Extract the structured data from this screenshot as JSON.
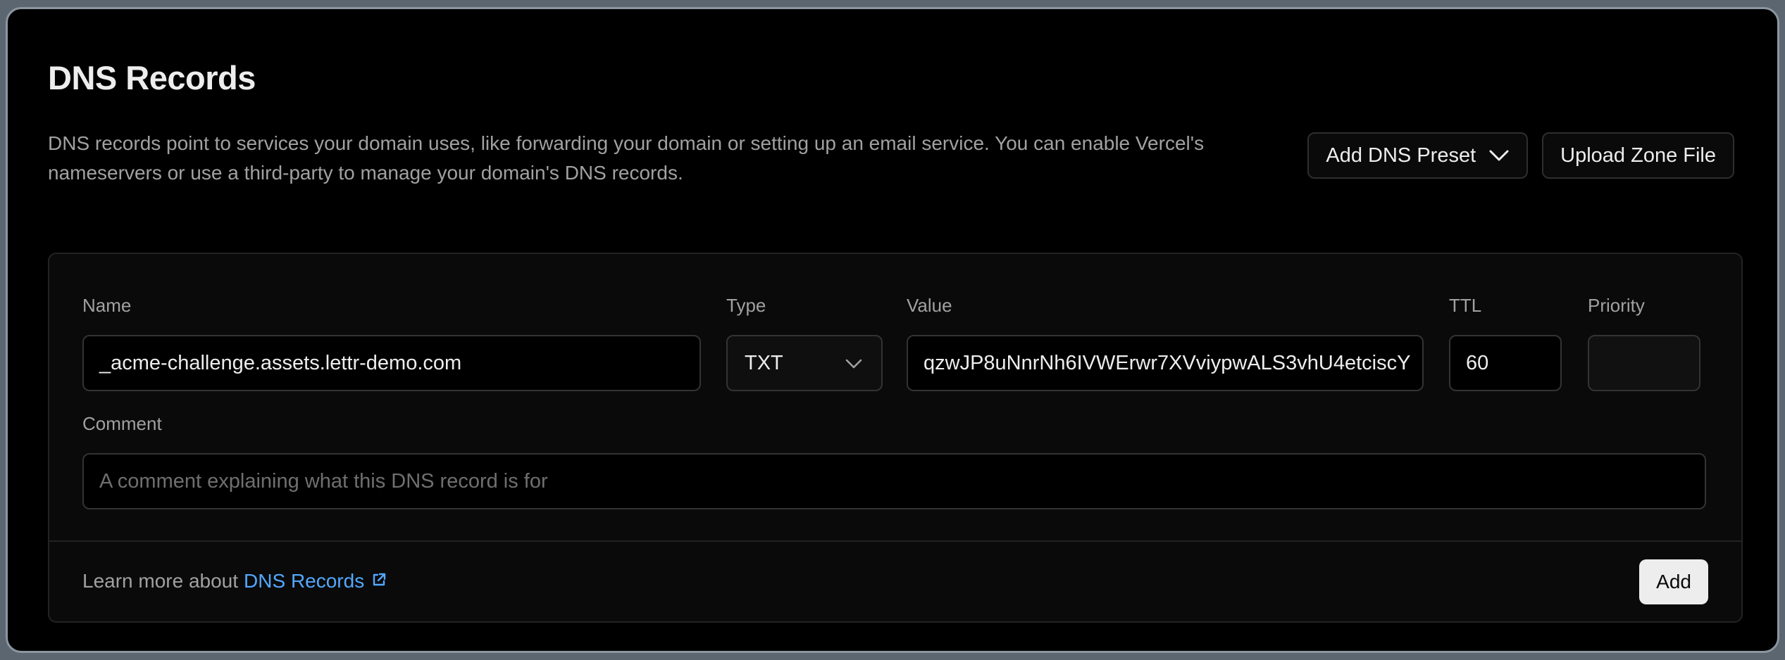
{
  "header": {
    "title": "DNS Records",
    "description": "DNS records point to services your domain uses, like forwarding your domain or setting up an email service. You can enable Vercel's nameservers or use a third-party to manage your domain's DNS records.",
    "preset_button": "Add DNS Preset",
    "upload_button": "Upload Zone File"
  },
  "form": {
    "name": {
      "label": "Name",
      "value": "_acme-challenge.assets.lettr-demo.com"
    },
    "type": {
      "label": "Type",
      "value": "TXT"
    },
    "value": {
      "label": "Value",
      "value": "qzwJP8uNnrNh6IVWErwr7XVviypwALS3vhU4etciscY"
    },
    "ttl": {
      "label": "TTL",
      "value": "60"
    },
    "priority": {
      "label": "Priority",
      "value": ""
    },
    "comment": {
      "label": "Comment",
      "placeholder": "A comment explaining what this DNS record is for"
    }
  },
  "footer": {
    "learn_more_prefix": "Learn more about",
    "learn_more_link": "DNS Records",
    "add_button": "Add"
  },
  "colors": {
    "background": "#000000",
    "card": "#0a0a0a",
    "link": "#52a8ff",
    "primary_button": "#ededed"
  },
  "icons": [
    "chevron-down-icon",
    "external-link-icon"
  ]
}
